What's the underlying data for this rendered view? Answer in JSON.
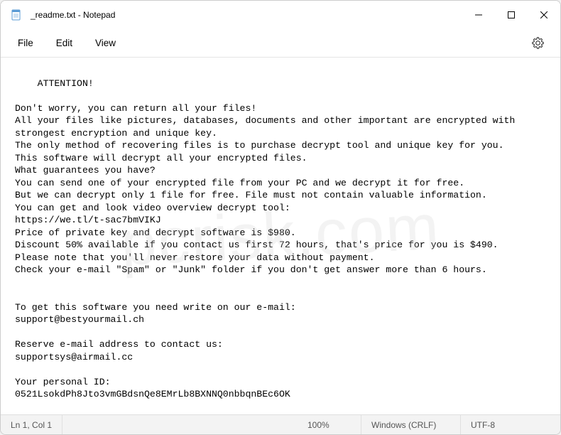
{
  "window": {
    "title": "_readme.txt - Notepad"
  },
  "menubar": {
    "file": "File",
    "edit": "Edit",
    "view": "View"
  },
  "document": {
    "content": "ATTENTION!\n\nDon't worry, you can return all your files!\nAll your files like pictures, databases, documents and other important are encrypted with strongest encryption and unique key.\nThe only method of recovering files is to purchase decrypt tool and unique key for you.\nThis software will decrypt all your encrypted files.\nWhat guarantees you have?\nYou can send one of your encrypted file from your PC and we decrypt it for free.\nBut we can decrypt only 1 file for free. File must not contain valuable information.\nYou can get and look video overview decrypt tool:\nhttps://we.tl/t-sac7bmVIKJ\nPrice of private key and decrypt software is $980.\nDiscount 50% available if you contact us first 72 hours, that's price for you is $490.\nPlease note that you'll never restore your data without payment.\nCheck your e-mail \"Spam\" or \"Junk\" folder if you don't get answer more than 6 hours.\n\n\nTo get this software you need write on our e-mail:\nsupport@bestyourmail.ch\n\nReserve e-mail address to contact us:\nsupportsys@airmail.cc\n\nYour personal ID:\n0521LsokdPh8Jto3vmGBdsnQe8EMrLb8BXNNQ0nbbqnBEc6OK"
  },
  "statusbar": {
    "cursor": "Ln 1, Col 1",
    "zoom": "100%",
    "line_ending": "Windows (CRLF)",
    "encoding": "UTF-8"
  },
  "watermark": "pcrisk.com"
}
